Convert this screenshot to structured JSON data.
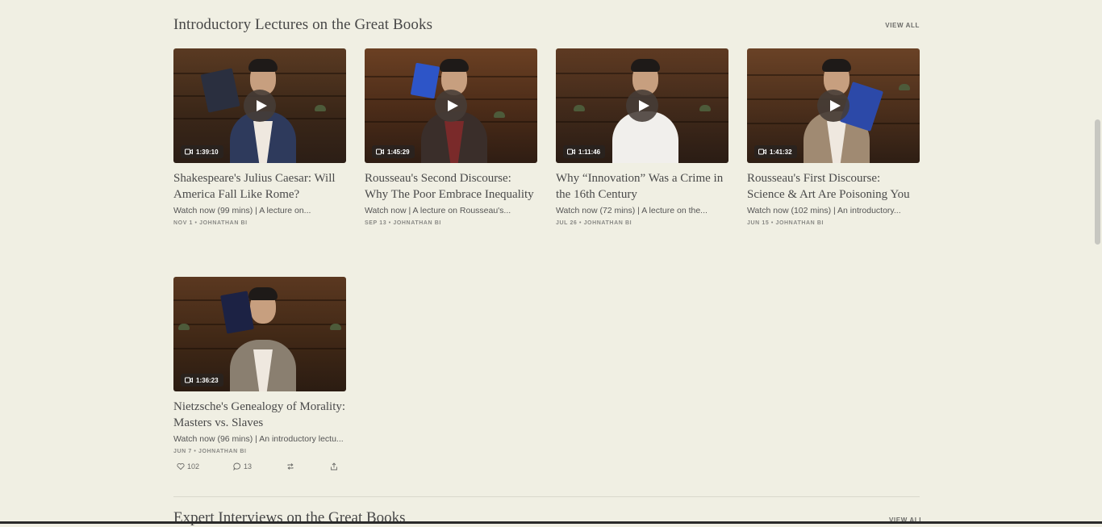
{
  "section": {
    "title": "Introductory Lectures on the Great Books",
    "view_all": "VIEW ALL"
  },
  "cards": [
    {
      "title": "Shakespeare's Julius Caesar: Will America Fall Like Rome?",
      "description": "Watch now (99 mins) | A lecture on...",
      "meta": "NOV 1 • JOHNATHAN BI",
      "duration": "1:39:10"
    },
    {
      "title": "Rousseau's Second Discourse: Why The Poor Embrace Inequality",
      "description": "Watch now | A lecture on Rousseau's...",
      "meta": "SEP 13 • JOHNATHAN BI",
      "duration": "1:45:29"
    },
    {
      "title": "Why “Innovation” Was a Crime in the 16th Century",
      "description": "Watch now (72 mins) | A lecture on the...",
      "meta": "JUL 26 • JOHNATHAN BI",
      "duration": "1:11:46"
    },
    {
      "title": "Rousseau's First Discourse: Science & Art Are Poisoning You",
      "description": "Watch now (102 mins) | An introductory...",
      "meta": "JUN 15 • JOHNATHAN BI",
      "duration": "1:41:32"
    },
    {
      "title": "Nietzsche's Genealogy of Morality: Masters vs. Slaves",
      "description": "Watch now (96 mins) | An introductory lectu...",
      "meta": "JUN 7 • JOHNATHAN BI",
      "duration": "1:36:23",
      "likes": "102",
      "comments": "13"
    }
  ],
  "next_section": {
    "title": "Expert Interviews on the Great Books",
    "view_all": "VIEW ALL"
  },
  "icons": {
    "play": "play-icon",
    "duration": "video-camera-icon",
    "like": "heart-icon",
    "comment": "comment-icon",
    "restack": "restack-icon",
    "share": "share-icon"
  },
  "colors": {
    "background": "#f0efe3",
    "title_text": "#474747",
    "meta_text": "#8a8a86"
  }
}
